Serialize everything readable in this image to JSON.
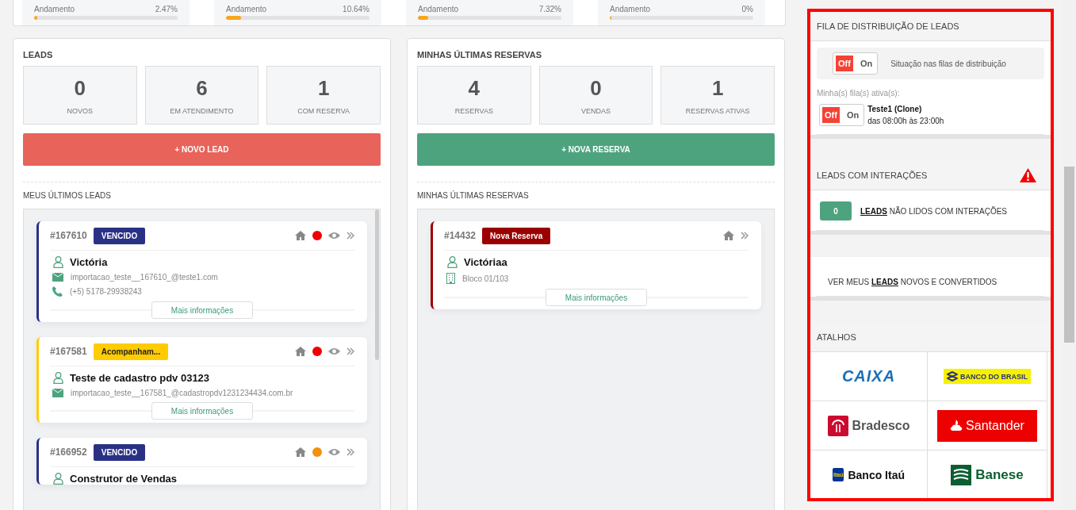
{
  "progress": [
    {
      "label": "Andamento",
      "value": "2.47%",
      "level": 0.0247
    },
    {
      "label": "Andamento",
      "value": "10.64%",
      "level": 0.1064
    },
    {
      "label": "Andamento",
      "value": "7.32%",
      "level": 0.0732
    },
    {
      "label": "Andamento",
      "value": "0%",
      "level": 0
    }
  ],
  "panels": [
    {
      "title": "LEADS",
      "stats": [
        {
          "value": "0",
          "label": "NOVOS"
        },
        {
          "value": "6",
          "label": "EM ATENDIMENTO"
        },
        {
          "value": "1",
          "label": "COM RESERVA"
        }
      ],
      "button": {
        "label": "+ NOVO LEAD",
        "color": "#e8635a"
      },
      "section_title": "MEUS ÚLTIMOS LEADS",
      "scrollbar": true,
      "cards": [
        {
          "id": "#167610",
          "badge": {
            "text": "VENCIDO",
            "color": "#2a3185"
          },
          "dot": {
            "color": "#f00000"
          },
          "name": "Victória",
          "details": [
            {
              "kind": "email",
              "text": "importacao_teste__167610_@teste1.com"
            },
            {
              "kind": "phone",
              "text": "(+5) 5178-29938243"
            }
          ],
          "more": "Mais informações"
        },
        {
          "id": "#167581",
          "badge": {
            "text": "Acompanham...",
            "color": "#ffcc00"
          },
          "dot": {
            "color": "#f00000"
          },
          "name": "Teste de cadastro pdv 03123",
          "details": [
            {
              "kind": "email",
              "text": "importacao_teste__167581_@cadastropdv1231234434.com.br"
            }
          ],
          "more": "Mais informações"
        },
        {
          "id": "#166952",
          "badge": {
            "text": "VENCIDO",
            "color": "#2a3185"
          },
          "dot": {
            "color": "#f39012"
          },
          "name": "Construtor de Vendas"
        }
      ]
    },
    {
      "title": "MINHAS ÚLTIMAS RESERVAS",
      "stats": [
        {
          "value": "4",
          "label": "RESERVAS"
        },
        {
          "value": "0",
          "label": "VENDAS"
        },
        {
          "value": "1",
          "label": "RESERVAS ATIVAS"
        }
      ],
      "button": {
        "label": "+ NOVA RESERVA",
        "color": "#4ea37f"
      },
      "section_title": "MINHAS ÚLTIMAS RESERVAS",
      "scrollbar": false,
      "cards": [
        {
          "id": "#14432",
          "badge": {
            "text": "Nova Reserva",
            "color": "#9b0000"
          },
          "name": "Victóriaa",
          "details": [
            {
              "kind": "building",
              "text": "Bloco 01/103"
            }
          ],
          "more": "Mais informações"
        }
      ]
    }
  ],
  "sidebar": {
    "queue": {
      "title": "FILA DE DISTRIBUIÇÃO DE LEADS",
      "toggle": {
        "off": "Off",
        "on": "On",
        "checked": false
      },
      "status_text": "Situação nas filas de distribuição",
      "active_label": "Minha(s) fila(s) ativa(s):",
      "queues": [
        {
          "toggle": {
            "off": "Off",
            "on": "On",
            "checked": false
          },
          "name": "Teste1 (Clone)",
          "hours": "das 08:00h às 23:00h"
        }
      ]
    },
    "interactions": {
      "title": "LEADS COM INTERAÇÕES",
      "count": "0",
      "link": "LEADS",
      "text": "NÃO LIDOS COM INTERAÇÕES"
    },
    "view": {
      "before": "VER MEUS",
      "link": "LEADS",
      "after": "NOVOS E CONVERTIDOS"
    },
    "shortcuts": {
      "title": "ATALHOS",
      "items": [
        {
          "kind": "caixa",
          "text": "CAIXA"
        },
        {
          "kind": "bb",
          "text": "BANCO DO BRASIL"
        },
        {
          "kind": "bradesco",
          "text": "Bradesco"
        },
        {
          "kind": "santander",
          "text": "Santander"
        },
        {
          "kind": "itau",
          "icon_text": "Itaú",
          "text": "Banco Itaú"
        },
        {
          "kind": "banese",
          "text": "Banese"
        }
      ]
    }
  }
}
